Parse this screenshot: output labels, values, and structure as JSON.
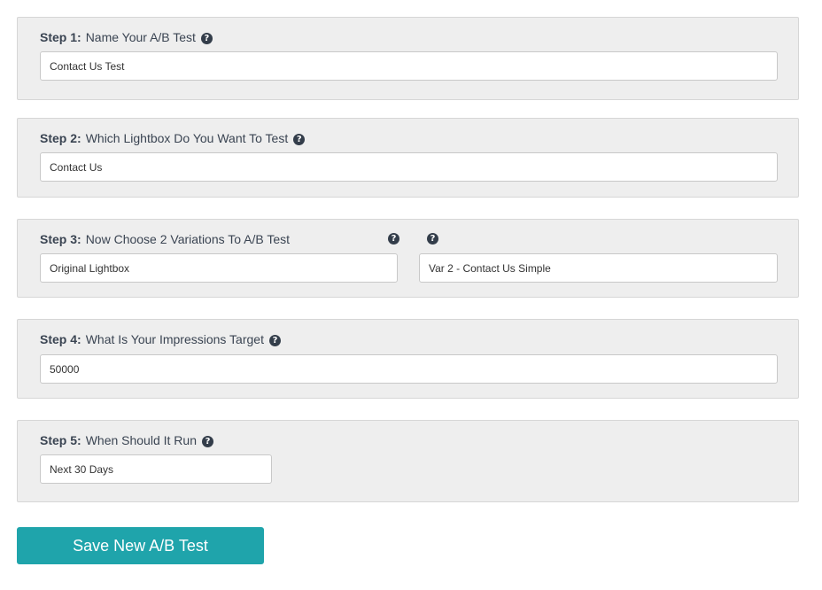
{
  "help_glyph": "?",
  "steps": [
    {
      "number": "Step 1:",
      "title": "Name Your A/B Test",
      "input_value": "Contact Us Test"
    },
    {
      "number": "Step 2:",
      "title": "Which Lightbox Do You Want To Test",
      "input_value": "Contact Us"
    },
    {
      "number": "Step 3:",
      "title": "Now Choose 2 Variations To A/B Test",
      "variation_a_value": "Original Lightbox",
      "variation_b_value": "Var 2 - Contact Us Simple"
    },
    {
      "number": "Step 4:",
      "title": "What Is Your Impressions Target",
      "input_value": "50000"
    },
    {
      "number": "Step 5:",
      "title": "When Should It Run",
      "input_value": "Next 30 Days"
    }
  ],
  "save_button_label": "Save New A/B Test",
  "colors": {
    "panel_background": "#eeeeee",
    "help_icon": "#333d4a",
    "button_background": "#1fa4ab",
    "text": "#3a4452"
  },
  "icons": {
    "help": "question-circle-icon"
  }
}
